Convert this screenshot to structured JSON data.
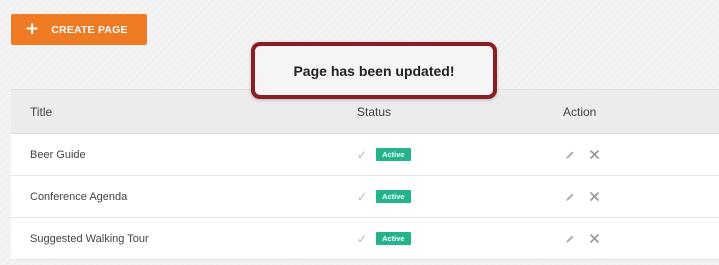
{
  "toolbar": {
    "create_label": "CREATE PAGE",
    "create_icon": "plus-icon"
  },
  "toast": {
    "message": "Page has been updated!",
    "border_color": "#8a1e24"
  },
  "table": {
    "columns": [
      "Title",
      "Status",
      "Action"
    ],
    "rows": [
      {
        "title": "Beer Guide",
        "status": "Active"
      },
      {
        "title": "Conference Agenda",
        "status": "Active"
      },
      {
        "title": "Suggested Walking Tour",
        "status": "Active"
      }
    ]
  },
  "colors": {
    "accent": "#ee7a23",
    "active_badge": "#23b48d"
  }
}
